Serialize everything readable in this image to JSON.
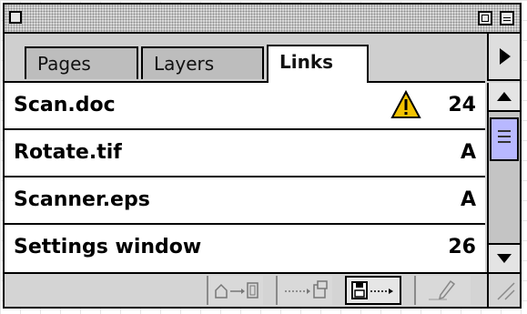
{
  "tabs": [
    {
      "label": "Pages",
      "active": false
    },
    {
      "label": "Layers",
      "active": false
    },
    {
      "label": "Links",
      "active": true
    }
  ],
  "links": [
    {
      "name": "Scan.doc",
      "page": "24",
      "warning": true
    },
    {
      "name": "Rotate.tif",
      "page": "A",
      "warning": false
    },
    {
      "name": "Scanner.eps",
      "page": "A",
      "warning": false
    },
    {
      "name": "Settings window",
      "page": "26",
      "warning": false
    }
  ],
  "toolbar": {
    "buttons": [
      {
        "icon": "relink-icon"
      },
      {
        "icon": "go-to-link-icon"
      },
      {
        "icon": "update-link-icon"
      },
      {
        "icon": "edit-original-icon"
      }
    ]
  },
  "colors": {
    "warning": "#f2c200",
    "scroll_thumb": "#b8b8ff"
  }
}
